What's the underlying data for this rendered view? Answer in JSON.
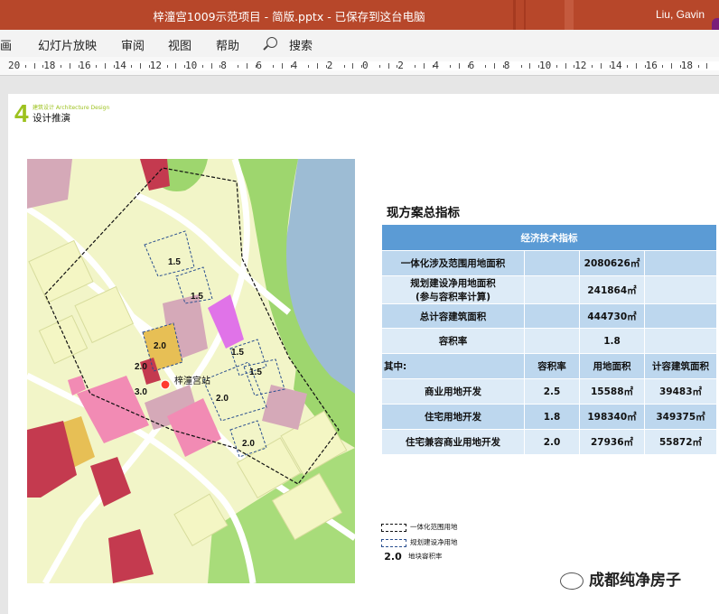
{
  "titlebar": {
    "title": "梓潼宫1009示范项目 - 简版.pptx  -  已保存到这台电脑",
    "user": "Liu, Gavin"
  },
  "menu": {
    "items": [
      "画",
      "幻灯片放映",
      "审阅",
      "视图",
      "帮助"
    ],
    "search_label": "搜索"
  },
  "ruler": {
    "labels": [
      "20",
      "18",
      "16",
      "14",
      "12",
      "10",
      "8",
      "6",
      "4",
      "2",
      "0",
      "2",
      "4",
      "6",
      "8",
      "10",
      "12",
      "14",
      "16",
      "18"
    ]
  },
  "slide": {
    "section_number": "4",
    "section_subtitle": "建筑设计 Architecture Design",
    "section_title": "设计推演",
    "map": {
      "station_label": "梓潼宫站",
      "far_labels": [
        "1.5",
        "1.5",
        "2.0",
        "1.5",
        "1.5",
        "2.0",
        "2.0",
        "3.0",
        "2.0",
        "2.0"
      ]
    },
    "table_title": "现方案总指标",
    "table": {
      "header": "经济技术指标",
      "row1_label": "一体化涉及范围用地面积",
      "row1_value": "2080626㎡",
      "row2_label_line1": "规划建设净用地面积",
      "row2_label_line2": "(参与容积率计算)",
      "row2_value": "241864㎡",
      "row3_label": "总计容建筑面积",
      "row3_value": "444730㎡",
      "row4_label": "容积率",
      "row4_value": "1.8",
      "sub_headers": [
        "其中:",
        "容积率",
        "用地面积",
        "计容建筑面积"
      ],
      "rows": [
        {
          "name": "商业用地开发",
          "far": "2.5",
          "area": "15588㎡",
          "gfa": "39483㎡"
        },
        {
          "name": "住宅用地开发",
          "far": "1.8",
          "area": "198340㎡",
          "gfa": "349375㎡"
        },
        {
          "name": "住宅兼容商业用地开发",
          "far": "2.0",
          "area": "27936㎡",
          "gfa": "55872㎡"
        }
      ]
    },
    "legend": {
      "item1": "一体化范围用地",
      "item2": "规划建设净用地",
      "item3_value": "2.0",
      "item3": "地块容积率"
    }
  },
  "watermark": "成都纯净房子",
  "colors": {
    "titlebar": "#b7472a",
    "accent_green": "#9dc21f",
    "table_header": "#5b9bd5",
    "table_row_a": "#bdd7ee",
    "table_row_b": "#ddebf7",
    "water": "#9dbcd4",
    "residential": "#f4f6c4",
    "park": "#9ed66e",
    "commercial": "#c43a4f",
    "station": "#ff3b30"
  }
}
